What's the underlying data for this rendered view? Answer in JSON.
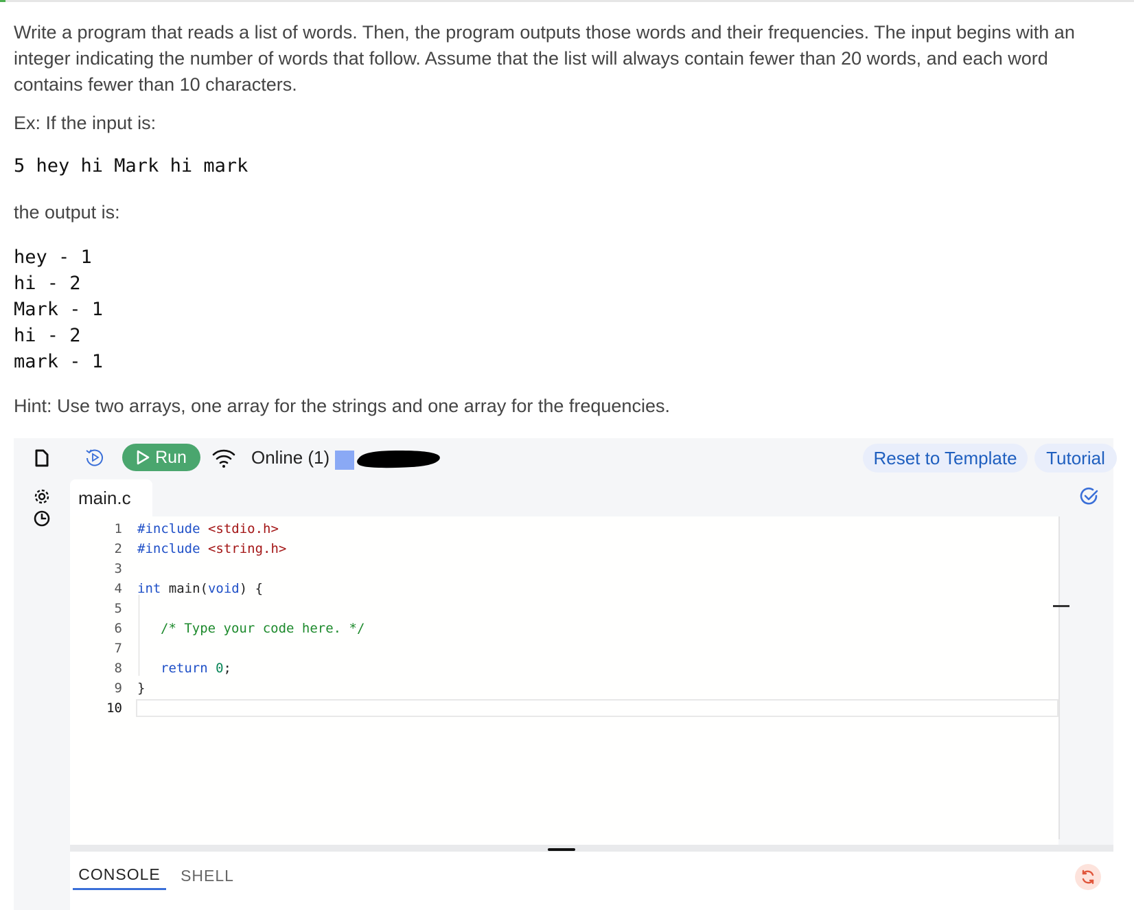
{
  "prompt": {
    "paragraph": "Write a program that reads a list of words. Then, the program outputs those words and their frequencies. The input begins with an integer indicating the number of words that follow. Assume that the list will always contain fewer than 20 words, and each word contains fewer than 10 characters.",
    "example_label": "Ex: If the input is:",
    "example_input": "5 hey hi Mark hi mark",
    "output_label": "the output is:",
    "output_lines": [
      "hey - 1",
      "hi - 2",
      "Mark - 1",
      "hi - 2",
      "mark - 1"
    ],
    "hint": "Hint: Use two arrays, one array for the strings and one array for the frequencies."
  },
  "toolbar": {
    "run_label": "Run",
    "online_status": "Online (1)",
    "reset_label": "Reset to Template",
    "tutorial_label": "Tutorial"
  },
  "editor": {
    "file_tab": "main.c",
    "line_numbers": [
      "1",
      "2",
      "3",
      "4",
      "5",
      "6",
      "7",
      "8",
      "9",
      "10"
    ],
    "code": {
      "l1_kw": "#include",
      "l1_str": "<stdio.h>",
      "l2_kw": "#include",
      "l2_str": "<string.h>",
      "l4_kw": "int",
      "l4_mid": " main(",
      "l4_kw2": "void",
      "l4_end": ") {",
      "l6_cm": "/* Type your code here. */",
      "l8_kw": "return",
      "l8_num": "0",
      "l8_end": ";",
      "l9": "}"
    }
  },
  "console": {
    "tabs": [
      "CONSOLE",
      "SHELL"
    ]
  },
  "colors": {
    "run_button": "#4aa66e",
    "link_blue": "#1f5fbf",
    "status_square": "#8aa9f5",
    "active_tab_underline": "#3a6fd8"
  },
  "icons": [
    "file-icon",
    "settings-gear-icon",
    "clock-icon",
    "history-icon",
    "play-icon",
    "wifi-icon",
    "check-circle-icon",
    "refresh-icon"
  ]
}
